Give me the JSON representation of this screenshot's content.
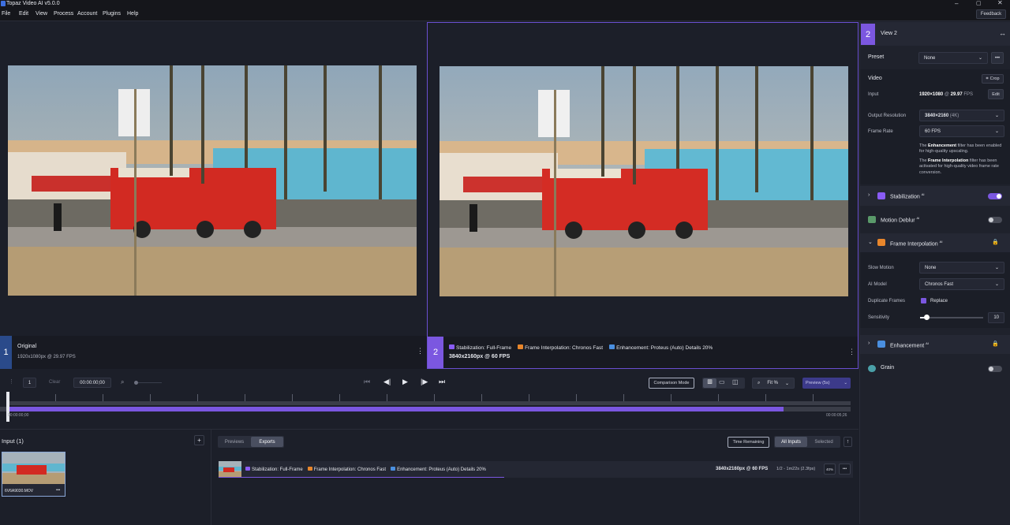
{
  "app": {
    "title": "Topaz Video AI  v5.0.0"
  },
  "menu": [
    "File",
    "Edit",
    "View",
    "Process",
    "Account",
    "Plugins",
    "Help"
  ],
  "feedback_label": "Feedback",
  "view1": {
    "number": "1",
    "name": "Original",
    "info": "1920x1080px @ 29.97 FPS"
  },
  "view2": {
    "number": "2",
    "filters": [
      {
        "label": "Stabilization: Full-Frame",
        "color": "#8a5cf6"
      },
      {
        "label": "Frame Interpolation: Chronos Fast",
        "color": "#e8862b"
      },
      {
        "label": "Enhancement: Proteus (Auto) Details 20%",
        "color": "#4a8fe0"
      }
    ],
    "info": "3840x2160px @ 60 FPS"
  },
  "panel": {
    "view_number": "2",
    "view_label": "View 2",
    "preset_label": "Preset",
    "preset_value": "None",
    "video_label": "Video",
    "crop_label": "Crop",
    "input_label": "Input",
    "input_res": "1920×1080",
    "input_at": "@",
    "input_fps": "29.97",
    "input_fps_unit": "FPS",
    "edit_label": "Edit",
    "output_res_label": "Output Resolution",
    "output_res_value": "3840×2160",
    "output_res_extra": "(4K)",
    "frame_rate_label": "Frame Rate",
    "frame_rate_value": "60 FPS",
    "note1_pre": "The ",
    "note1_bold": "Enhancement",
    "note1_post": " filter has been enabled for high-quality upscaling.",
    "note2_pre": "The ",
    "note2_bold": "Frame Interpolation",
    "note2_post": " filter has been activated for high-quality video frame rate conversion.",
    "stabilization_label": "Stabilization",
    "ai_sup": "AI",
    "motion_deblur_label": "Motion Deblur",
    "frame_interp_label": "Frame Interpolation",
    "slow_motion_label": "Slow Motion",
    "slow_motion_value": "None",
    "ai_model_label": "AI Model",
    "ai_model_value": "Chronos Fast",
    "dup_frames_label": "Duplicate Frames",
    "dup_frames_value": "Replace",
    "sensitivity_label": "Sensitivity",
    "sensitivity_value": "10",
    "sensitivity_level": 0.1,
    "enhancement_label": "Enhancement",
    "grain_label": "Grain"
  },
  "toolbar": {
    "frame": "1",
    "clear": "Clear",
    "timecode": "00:00:00;00",
    "comparison_mode": "Comparison Mode",
    "fit_label": "Fit",
    "fit_unit": "%",
    "preview_label": "Preview (5s)"
  },
  "timeline": {
    "start": "00:00:00;00",
    "end": "00:00:05;26",
    "progress": 0.92
  },
  "input_panel": {
    "title": "Input (1)",
    "file": "6V6A9030.MOV",
    "more": "•••"
  },
  "exports": {
    "tabs": [
      "Previews",
      "Exports"
    ],
    "time_remaining": "Time Remaining",
    "all_inputs": "All Inputs",
    "selected": "Selected",
    "row": {
      "filters": [
        {
          "label": "Stabilization: Full-Frame",
          "color": "#8a5cf6"
        },
        {
          "label": "Frame Interpolation: Chronos Fast",
          "color": "#e8862b"
        },
        {
          "label": "Enhancement: Proteus (Auto) Details 20%",
          "color": "#4a8fe0"
        }
      ],
      "res": "3840x2160px @ 60 FPS",
      "progress_text": "1/2 -  1m22s (2.3fps)",
      "pct": "40%",
      "more": "•••"
    }
  }
}
